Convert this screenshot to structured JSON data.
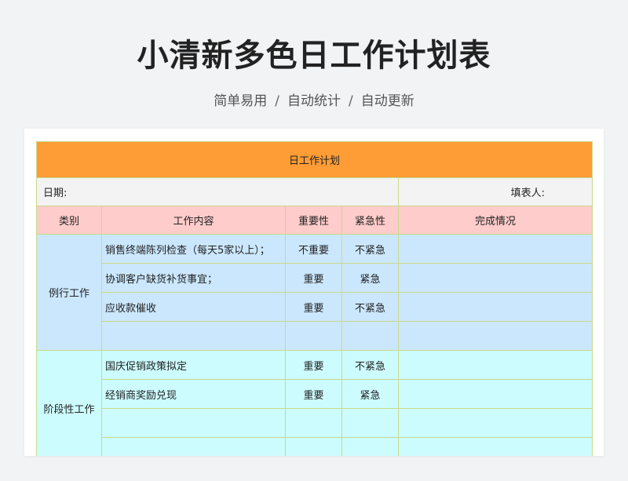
{
  "page": {
    "title": "小清新多色日工作计划表",
    "subtitle_items": [
      "简单易用",
      "自动统计",
      "自动更新"
    ],
    "subtitle_separator": "/"
  },
  "sheet": {
    "title": "日工作计划",
    "date_label": "日期:",
    "filler_label": "填表人:",
    "headers": {
      "category": "类别",
      "content": "工作内容",
      "importance": "重要性",
      "urgency": "紧急性",
      "status": "完成情况"
    },
    "groups": [
      {
        "category": "例行工作",
        "rows": [
          {
            "content": "销售终端陈列检查（每天5家以上）；",
            "importance": "不重要",
            "urgency": "不紧急",
            "status": ""
          },
          {
            "content": "协调客户缺货补货事宜；",
            "importance": "重要",
            "urgency": "紧急",
            "status": ""
          },
          {
            "content": "应收款催收",
            "importance": "重要",
            "urgency": "不紧急",
            "status": ""
          },
          {
            "content": "",
            "importance": "",
            "urgency": "",
            "status": ""
          }
        ]
      },
      {
        "category": "阶段性工作",
        "rows": [
          {
            "content": "国庆促销政策拟定",
            "importance": "重要",
            "urgency": "不紧急",
            "status": ""
          },
          {
            "content": "经销商奖励兑现",
            "importance": "重要",
            "urgency": "紧急",
            "status": ""
          },
          {
            "content": "",
            "importance": "",
            "urgency": "",
            "status": ""
          },
          {
            "content": "",
            "importance": "",
            "urgency": "",
            "status": ""
          }
        ]
      }
    ],
    "colors": {
      "title_bar": "#fe9c35",
      "header_row": "#fecccb",
      "group_1": "#cbe7fd",
      "group_2": "#cdfcfe",
      "grid": "#c9d98a"
    }
  }
}
